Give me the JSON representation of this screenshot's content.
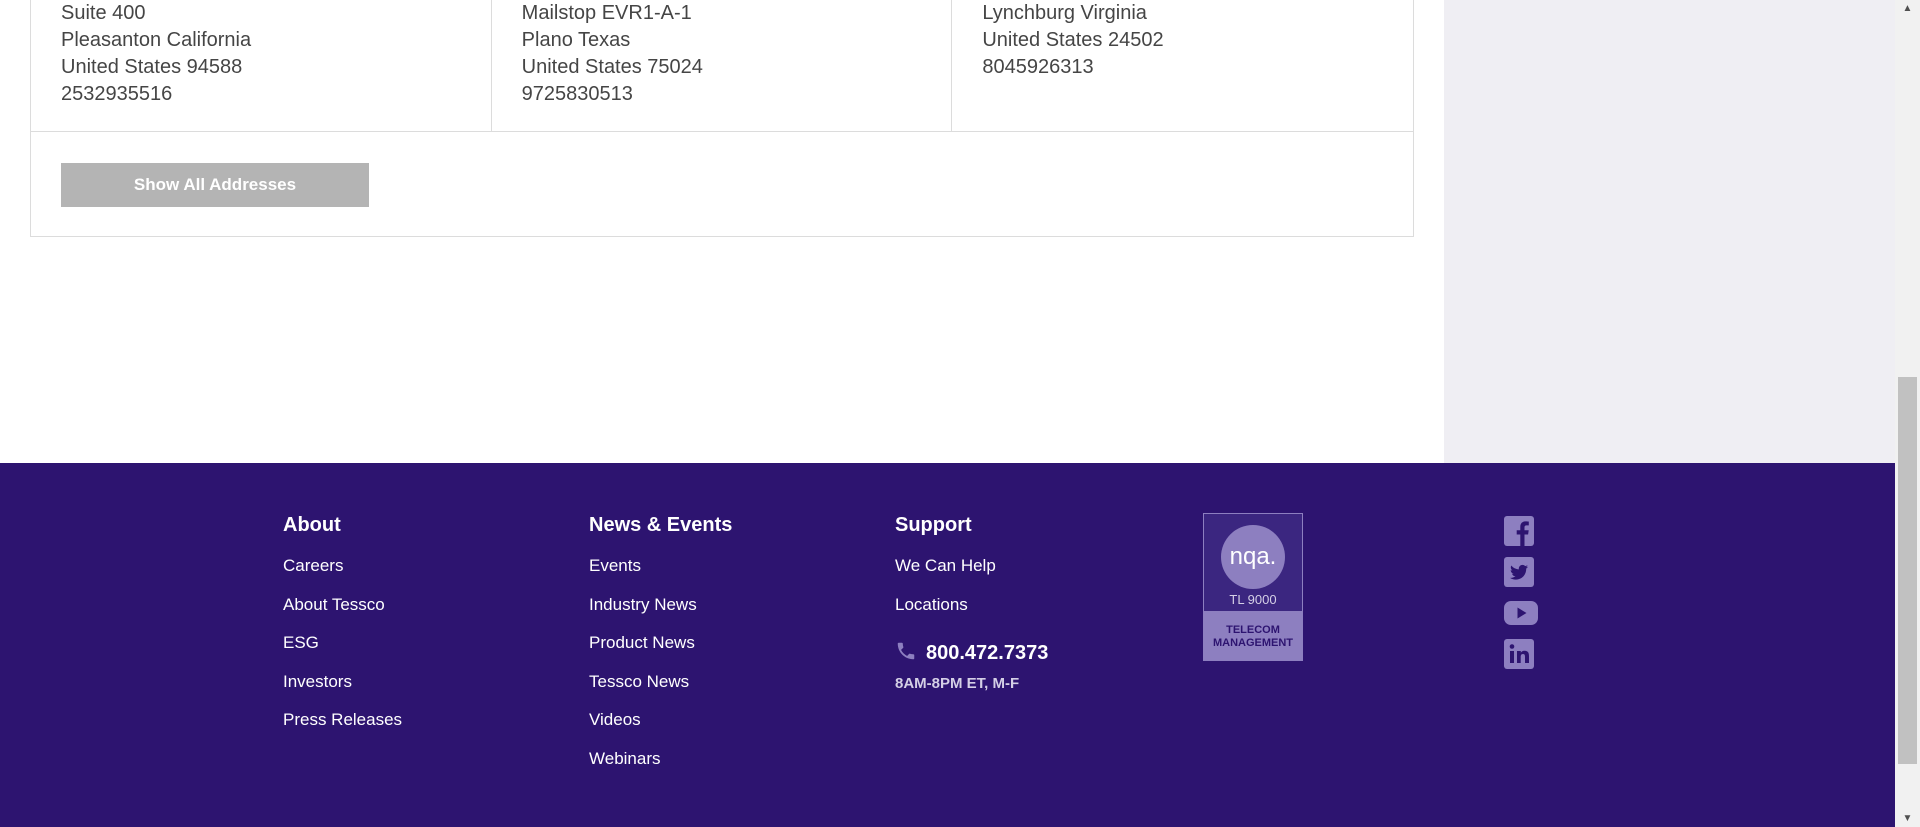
{
  "addresses": [
    {
      "lines": [
        "Suite 400",
        "Pleasanton California",
        "United States 94588",
        "2532935516"
      ]
    },
    {
      "lines": [
        "Mailstop EVR1-A-1",
        "Plano Texas",
        "United States 75024",
        "9725830513"
      ]
    },
    {
      "lines": [
        "Lynchburg Virginia",
        "United States 24502",
        "8045926313"
      ]
    }
  ],
  "show_all_label": "Show All Addresses",
  "footer": {
    "about": {
      "heading": "About",
      "links": [
        "Careers",
        "About Tessco",
        "ESG",
        "Investors",
        "Press Releases"
      ]
    },
    "news": {
      "heading": "News & Events",
      "links": [
        "Events",
        "Industry News",
        "Product News",
        "Tessco News",
        "Videos",
        "Webinars"
      ]
    },
    "support": {
      "heading": "Support",
      "links": [
        "We Can Help",
        "Locations"
      ],
      "phone": "800.472.7373",
      "hours": "8AM-8PM ET, M-F"
    },
    "badge": {
      "logo": "nqa.",
      "standard": "TL 9000",
      "caption": "TELECOM MANAGEMENT"
    },
    "social": [
      "facebook-icon",
      "twitter-icon",
      "youtube-icon",
      "linkedin-icon"
    ]
  },
  "colors": {
    "footer_bg": "#2d1470",
    "badge_accent": "#8d7fc0",
    "button_gray": "#b4b4b4",
    "side_panel": "#efeef3"
  }
}
